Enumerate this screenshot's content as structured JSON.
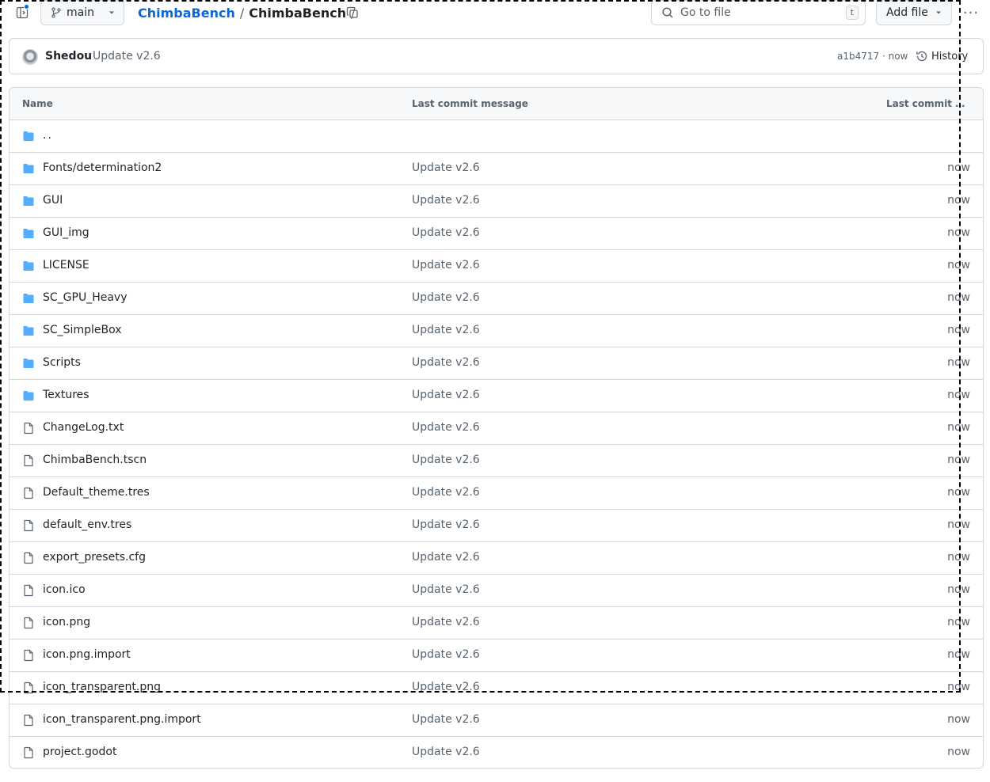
{
  "topbar": {
    "branch": "main",
    "breadcrumb": {
      "repo": "ChimbaBench",
      "current": "ChimbaBench",
      "sep1": "/",
      "sep2": "/"
    },
    "search_placeholder": "Go to file",
    "search_shortcut": "t",
    "add_file": "Add file",
    "more": "···"
  },
  "commit": {
    "author": "Shedou",
    "message": "Update v2.6",
    "sha_time": "a1b4717 · now",
    "history": "History"
  },
  "table": {
    "headers": {
      "name": "Name",
      "message": "Last commit message",
      "date": "Last commit date"
    },
    "parent": "..",
    "rows": [
      {
        "name": "Fonts/determination2",
        "type": "folder",
        "message": "Update v2.6",
        "date": "now"
      },
      {
        "name": "GUI",
        "type": "folder",
        "message": "Update v2.6",
        "date": "now"
      },
      {
        "name": "GUI_img",
        "type": "folder",
        "message": "Update v2.6",
        "date": "now"
      },
      {
        "name": "LICENSE",
        "type": "folder",
        "message": "Update v2.6",
        "date": "now"
      },
      {
        "name": "SC_GPU_Heavy",
        "type": "folder",
        "message": "Update v2.6",
        "date": "now"
      },
      {
        "name": "SC_SimpleBox",
        "type": "folder",
        "message": "Update v2.6",
        "date": "now"
      },
      {
        "name": "Scripts",
        "type": "folder",
        "message": "Update v2.6",
        "date": "now"
      },
      {
        "name": "Textures",
        "type": "folder",
        "message": "Update v2.6",
        "date": "now"
      },
      {
        "name": "ChangeLog.txt",
        "type": "file",
        "message": "Update v2.6",
        "date": "now"
      },
      {
        "name": "ChimbaBench.tscn",
        "type": "file",
        "message": "Update v2.6",
        "date": "now"
      },
      {
        "name": "Default_theme.tres",
        "type": "file",
        "message": "Update v2.6",
        "date": "now"
      },
      {
        "name": "default_env.tres",
        "type": "file",
        "message": "Update v2.6",
        "date": "now"
      },
      {
        "name": "export_presets.cfg",
        "type": "file",
        "message": "Update v2.6",
        "date": "now"
      },
      {
        "name": "icon.ico",
        "type": "file",
        "message": "Update v2.6",
        "date": "now"
      },
      {
        "name": "icon.png",
        "type": "file",
        "message": "Update v2.6",
        "date": "now"
      },
      {
        "name": "icon.png.import",
        "type": "file",
        "message": "Update v2.6",
        "date": "now"
      },
      {
        "name": "icon_transparent.png",
        "type": "file",
        "message": "Update v2.6",
        "date": "now"
      },
      {
        "name": "icon_transparent.png.import",
        "type": "file",
        "message": "Update v2.6",
        "date": "now"
      },
      {
        "name": "project.godot",
        "type": "file",
        "message": "Update v2.6",
        "date": "now"
      }
    ]
  },
  "colors": {
    "link": "#0969da",
    "folder": "#54aeff",
    "border": "#d0d7de",
    "muted": "#59636e"
  }
}
